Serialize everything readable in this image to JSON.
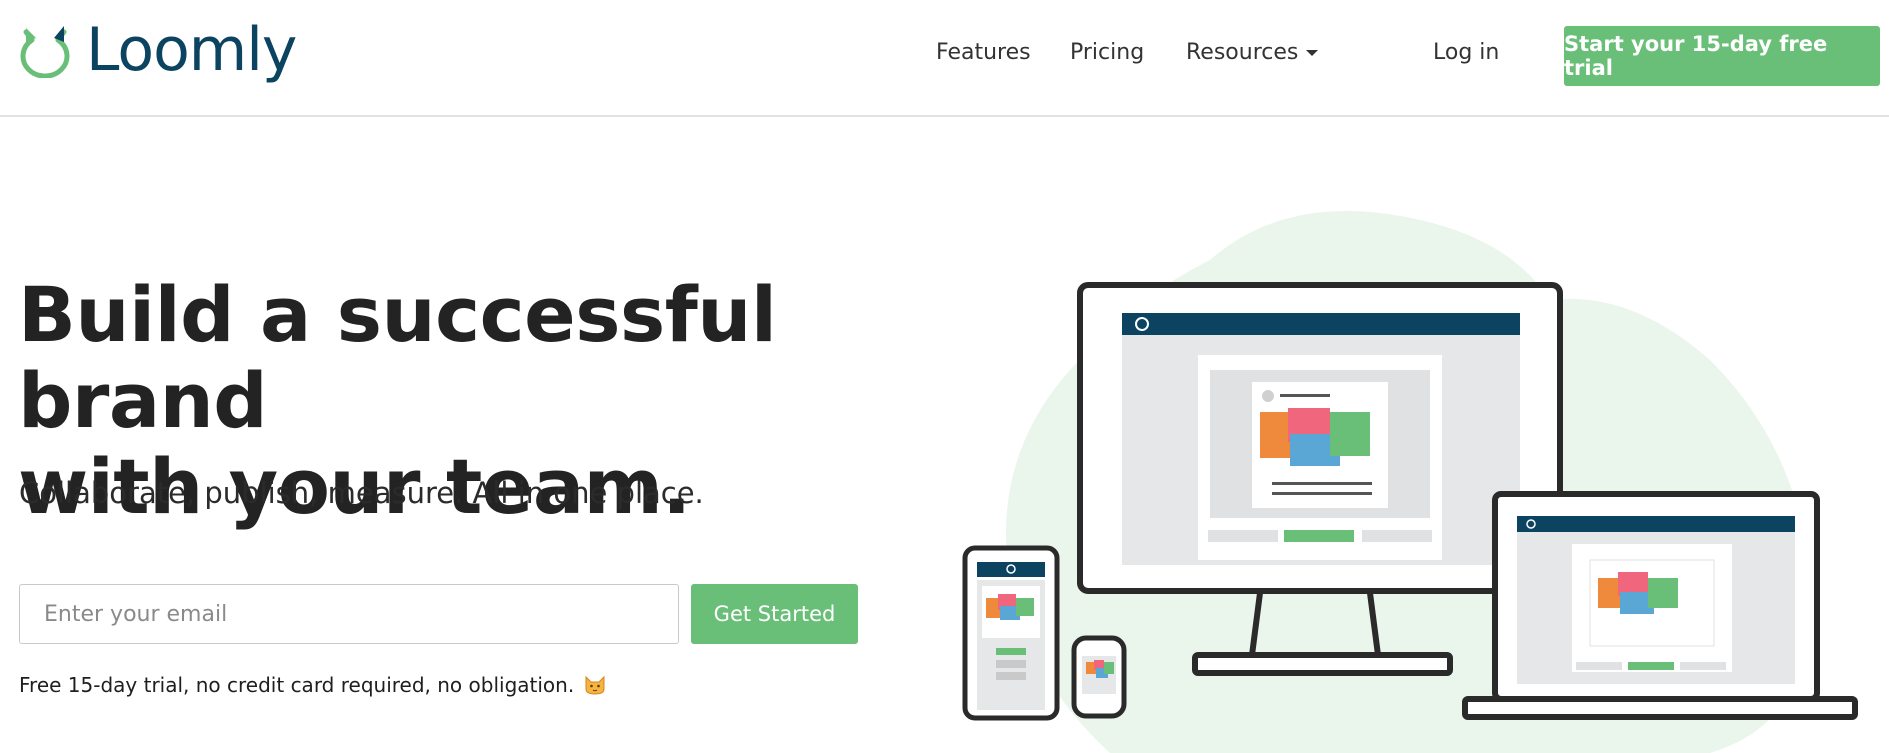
{
  "brand": {
    "name": "Loomly",
    "colors": {
      "navy": "#0b4360",
      "green": "#69bf77",
      "text": "#222222"
    }
  },
  "nav": {
    "features": "Features",
    "pricing": "Pricing",
    "resources": "Resources",
    "login": "Log in",
    "cta": "Start your 15-day free trial"
  },
  "hero": {
    "headline_line1": "Build a successful brand",
    "headline_line2": "with your team.",
    "subheadline": "Collaborate, publish, measure. All in one place.",
    "email_placeholder": "Enter your email",
    "submit_label": "Get Started",
    "note": "Free 15-day trial, no credit card required, no obligation."
  },
  "icons": {
    "logo": "cat-head-icon",
    "resources_dropdown": "caret-down-icon",
    "note_emoji": "cat-emoji-icon"
  }
}
